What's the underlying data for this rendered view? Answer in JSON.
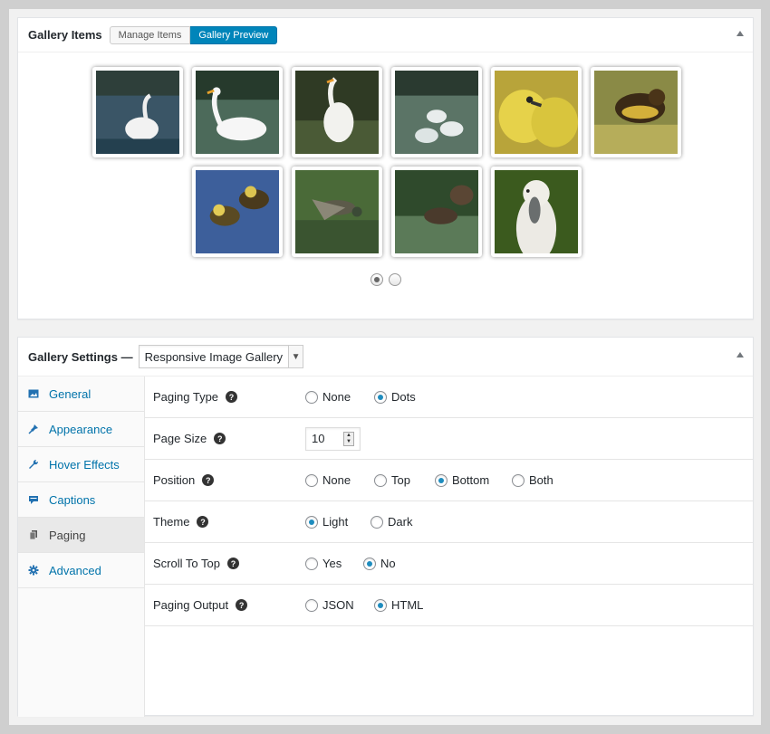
{
  "gallery_items": {
    "title": "Gallery Items",
    "buttons": [
      {
        "label": "Manage Items",
        "active": false
      },
      {
        "label": "Gallery Preview",
        "active": true
      }
    ],
    "images": [
      {
        "subject": "white swan on water"
      },
      {
        "subject": "white goose"
      },
      {
        "subject": "white goose standing"
      },
      {
        "subject": "swans swimming"
      },
      {
        "subject": "yellow goslings"
      },
      {
        "subject": "duckling on water"
      },
      {
        "subject": "ducklings swimming"
      },
      {
        "subject": "duck in flight"
      },
      {
        "subject": "ducks on pond"
      },
      {
        "subject": "white duck portrait"
      }
    ],
    "pages": 2,
    "current_page": 1
  },
  "gallery_settings": {
    "title": "Gallery Settings —",
    "template_select": "Responsive Image Gallery",
    "tabs": [
      {
        "label": "General",
        "icon": "image-icon",
        "active": false
      },
      {
        "label": "Appearance",
        "icon": "paint-pin-icon",
        "active": false
      },
      {
        "label": "Hover Effects",
        "icon": "wrench-icon",
        "active": false
      },
      {
        "label": "Captions",
        "icon": "caption-icon",
        "active": false
      },
      {
        "label": "Paging",
        "icon": "pages-icon",
        "active": true
      },
      {
        "label": "Advanced",
        "icon": "gear-icon",
        "active": false
      }
    ],
    "rows": {
      "paging_type": {
        "label": "Paging Type",
        "options": [
          "None",
          "Dots"
        ],
        "selected": "Dots"
      },
      "page_size": {
        "label": "Page Size",
        "value": "10"
      },
      "position": {
        "label": "Position",
        "options": [
          "None",
          "Top",
          "Bottom",
          "Both"
        ],
        "selected": "Bottom"
      },
      "theme": {
        "label": "Theme",
        "options": [
          "Light",
          "Dark"
        ],
        "selected": "Light"
      },
      "scroll_to_top": {
        "label": "Scroll To Top",
        "options": [
          "Yes",
          "No"
        ],
        "selected": "No"
      },
      "paging_output": {
        "label": "Paging Output",
        "options": [
          "JSON",
          "HTML"
        ],
        "selected": "HTML"
      }
    },
    "help_glyph": "?"
  },
  "colors": {
    "accent": "#0085ba",
    "radio_checked": "#1e8cbe",
    "link": "#0073aa"
  }
}
